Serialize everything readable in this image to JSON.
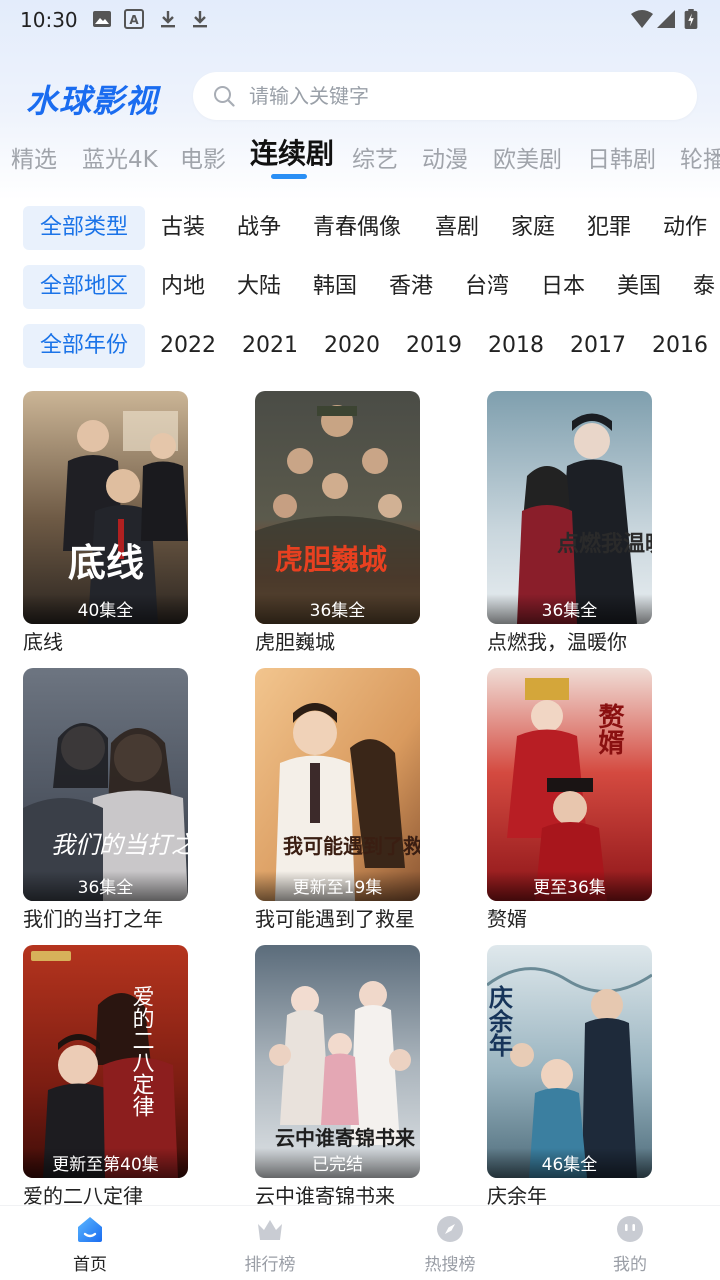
{
  "status_bar": {
    "time": "10:30",
    "icons": [
      "image-icon",
      "a-icon",
      "download-icon",
      "download-icon",
      "wifi-icon",
      "signal-icon",
      "battery-icon"
    ]
  },
  "header": {
    "logo": "水球影视",
    "search": {
      "placeholder": "请输入关键字",
      "value": ""
    }
  },
  "channel_tabs": [
    {
      "label": "精选",
      "active": false
    },
    {
      "label": "蓝光4K",
      "active": false
    },
    {
      "label": "电影",
      "active": false
    },
    {
      "label": "连续剧",
      "active": true
    },
    {
      "label": "综艺",
      "active": false
    },
    {
      "label": "动漫",
      "active": false
    },
    {
      "label": "欧美剧",
      "active": false
    },
    {
      "label": "日韩剧",
      "active": false
    },
    {
      "label": "轮播",
      "active": false
    }
  ],
  "filters": {
    "type": {
      "active": "全部类型",
      "options": [
        "古装",
        "战争",
        "青春偶像",
        "喜剧",
        "家庭",
        "犯罪",
        "动作"
      ]
    },
    "region": {
      "active": "全部地区",
      "options": [
        "内地",
        "大陆",
        "韩国",
        "香港",
        "台湾",
        "日本",
        "美国",
        "泰"
      ]
    },
    "year": {
      "active": "全部年份",
      "options": [
        "2022",
        "2021",
        "2020",
        "2019",
        "2018",
        "2017",
        "2016"
      ]
    }
  },
  "shows": [
    {
      "title": "底线",
      "badge": "40集全",
      "poster_text": "底线"
    },
    {
      "title": "虎胆巍城",
      "badge": "36集全",
      "poster_text": "虎胆巍城"
    },
    {
      "title": "点燃我，温暖你",
      "badge": "36集全",
      "poster_text": "点燃我温暖你"
    },
    {
      "title": "我们的当打之年",
      "badge": "36集全",
      "poster_text": "我们的当打之年"
    },
    {
      "title": "我可能遇到了救星",
      "badge": "更新至19集",
      "poster_text": "我可能遇到了救星"
    },
    {
      "title": "赘婿",
      "badge": "更至36集",
      "poster_text": "赘婿"
    },
    {
      "title": "爱的二八定律",
      "badge": "更新至第40集",
      "poster_text": "爱的二八定律"
    },
    {
      "title": "云中谁寄锦书来",
      "badge": "已完结",
      "poster_text": "云中谁寄锦书来"
    },
    {
      "title": "庆余年",
      "badge": "46集全",
      "poster_text": "庆余年"
    }
  ],
  "bottom_nav": [
    {
      "label": "首页",
      "icon": "home-icon",
      "active": true
    },
    {
      "label": "排行榜",
      "icon": "crown-icon",
      "active": false
    },
    {
      "label": "热搜榜",
      "icon": "compass-icon",
      "active": false
    },
    {
      "label": "我的",
      "icon": "profile-icon",
      "active": false
    }
  ],
  "colors": {
    "accent": "#1a73e8",
    "logo": "#1a6cf0",
    "indicator": "#2a8ff5"
  }
}
